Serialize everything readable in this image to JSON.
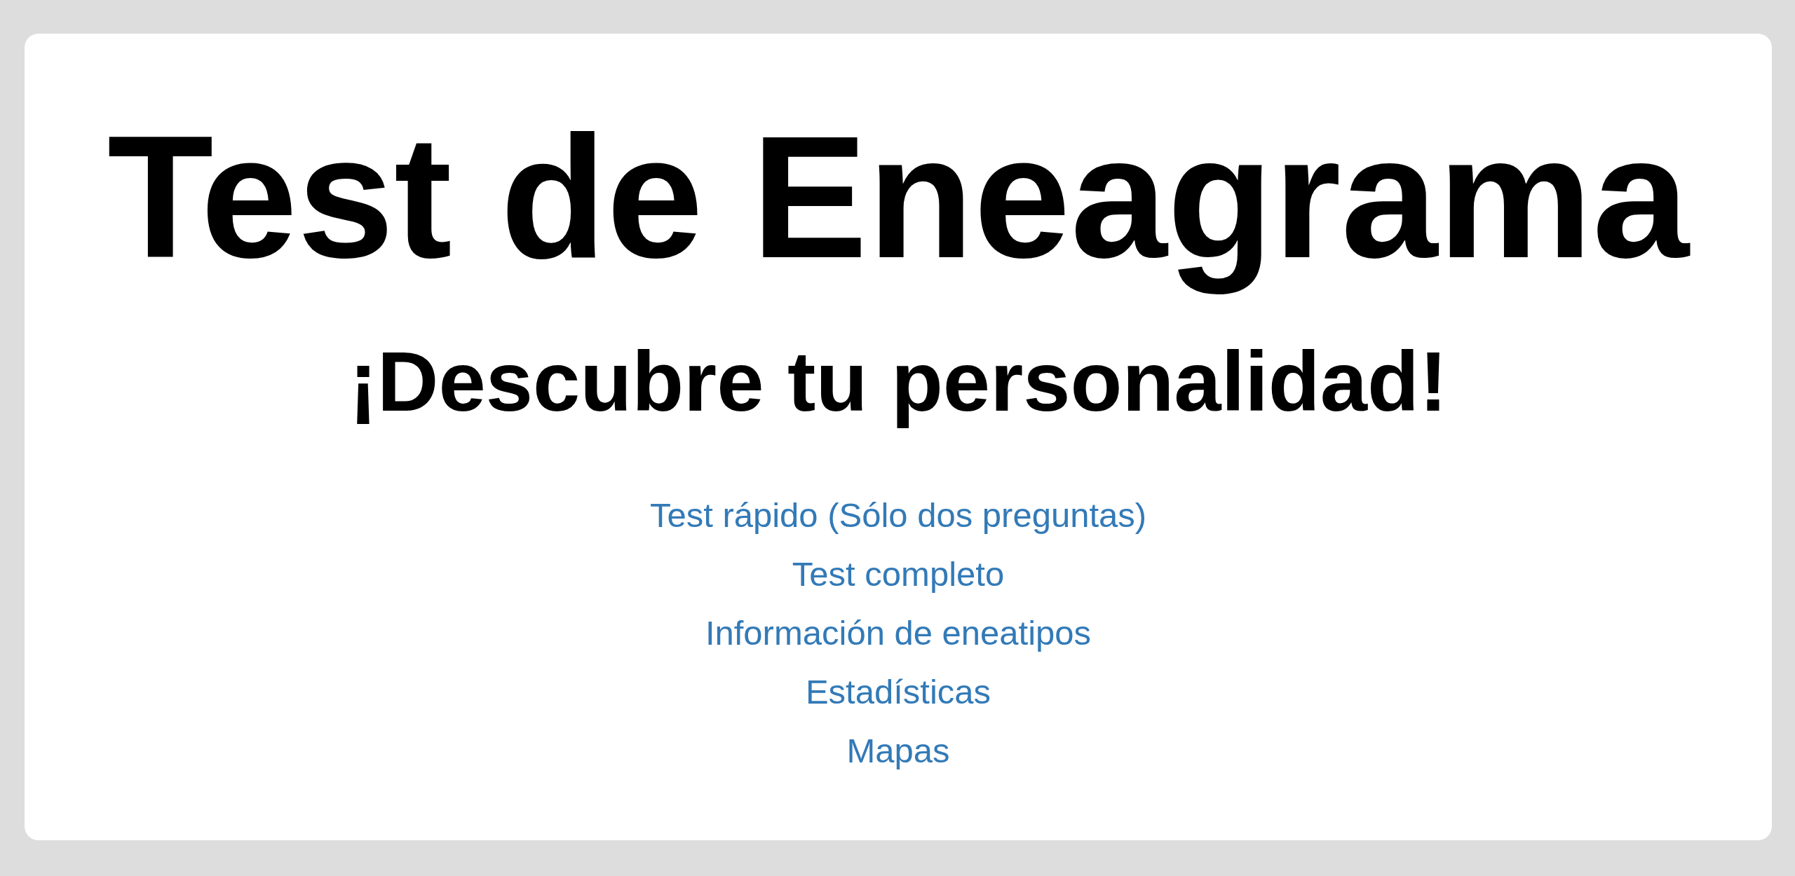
{
  "title": "Test de Eneagrama",
  "subtitle": "¡Descubre tu personalidad!",
  "links": [
    {
      "label": "Test rápido (Sólo dos preguntas)"
    },
    {
      "label": "Test completo"
    },
    {
      "label": "Información de eneatipos"
    },
    {
      "label": "Estadísticas"
    },
    {
      "label": "Mapas"
    }
  ]
}
